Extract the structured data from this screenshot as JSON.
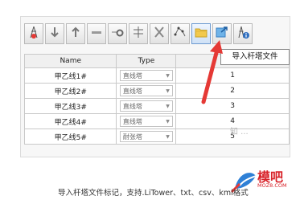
{
  "toolbar": {
    "tooltip": "导入杆塔文件",
    "buttons": [
      {
        "name": "tower-location-icon"
      },
      {
        "name": "insert-below-icon"
      },
      {
        "name": "insert-above-icon"
      },
      {
        "name": "delete-row-icon"
      },
      {
        "name": "tower-setting-icon"
      },
      {
        "name": "cross-arm-icon"
      },
      {
        "name": "tower-tool-icon"
      },
      {
        "name": "route-icon"
      },
      {
        "name": "folder-open-icon"
      },
      {
        "name": "export-icon"
      },
      {
        "name": "tower-info-icon"
      }
    ]
  },
  "table": {
    "headers": [
      "Name",
      "Type",
      ""
    ],
    "rows": [
      {
        "name": "甲乙线1#",
        "type": "直线塔",
        "index": "1"
      },
      {
        "name": "甲乙线2#",
        "type": "直线塔",
        "index": "2"
      },
      {
        "name": "甲乙线3#",
        "type": "直线塔",
        "index": "3"
      },
      {
        "name": "甲乙线4#",
        "type": "直线塔",
        "index": "4"
      },
      {
        "name": "甲乙线5#",
        "type": "耐张塔",
        "index": "5"
      }
    ]
  },
  "watermark": "知 ...",
  "logo": {
    "text": "模吧",
    "sub": "MOZ8.COM"
  },
  "caption": "导入杆塔文件标记，支持.LiTower、txt、csv、kml格式",
  "colors": {
    "arrow": "#e53935",
    "logo": "#d8232a"
  }
}
